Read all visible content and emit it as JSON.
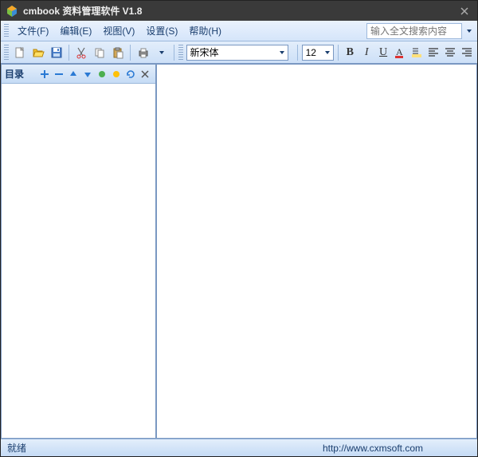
{
  "titlebar": {
    "title": "cmbook 资料管理软件 V1.8"
  },
  "menubar": {
    "items": [
      {
        "label": "文件(F)"
      },
      {
        "label": "编辑(E)"
      },
      {
        "label": "视图(V)"
      },
      {
        "label": "设置(S)"
      },
      {
        "label": "帮助(H)"
      }
    ],
    "search_placeholder": "输入全文搜索内容"
  },
  "toolbar": {
    "font_name": "新宋体",
    "font_size": "12"
  },
  "sidebar": {
    "title": "目录"
  },
  "statusbar": {
    "status": "就绪",
    "url": "http://www.cxmsoft.com"
  }
}
